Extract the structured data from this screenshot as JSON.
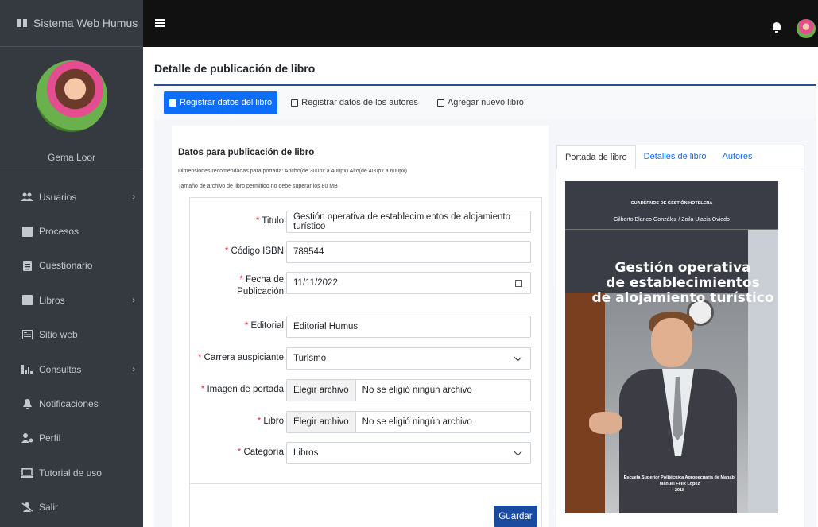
{
  "app": {
    "brand": "Sistema Web Humus",
    "user_name": "Gema Loor"
  },
  "sidebar": {
    "items": [
      {
        "label": "Usuarios",
        "icon": "users-icon",
        "has_submenu": true
      },
      {
        "label": "Procesos",
        "icon": "clipboard-icon",
        "has_submenu": false
      },
      {
        "label": "Cuestionario",
        "icon": "file-text-icon",
        "has_submenu": false
      },
      {
        "label": "Libros",
        "icon": "book-icon",
        "has_submenu": true
      },
      {
        "label": "Sitio web",
        "icon": "website-icon",
        "has_submenu": false
      },
      {
        "label": "Consultas",
        "icon": "bar-chart-icon",
        "has_submenu": true
      },
      {
        "label": "Notificaciones",
        "icon": "bell-icon",
        "has_submenu": false
      },
      {
        "label": "Perfil",
        "icon": "user-cog-icon",
        "has_submenu": false
      },
      {
        "label": "Tutorial de uso",
        "icon": "laptop-icon",
        "has_submenu": false
      },
      {
        "label": "Salir",
        "icon": "logout-icon",
        "has_submenu": false
      }
    ]
  },
  "page": {
    "title": "Detalle de publicación de libro"
  },
  "top_tabs": [
    {
      "label": "Registrar datos del libro",
      "active": true
    },
    {
      "label": "Registrar datos de los autores",
      "active": false
    },
    {
      "label": "Agregar nuevo libro",
      "active": false
    }
  ],
  "form": {
    "heading": "Datos para publicación de libro",
    "hint_dimensions": "Dimensiones recomendadas para portada: Ancho(de 300px a 400px) Alto(de 400px a 600px)",
    "hint_size": "Tamaño de archivo de libro permitido no debe superar los 80 MB",
    "required_mark": "*",
    "titulo": {
      "label": "Titulo",
      "value": "Gestión operativa de establecimientos de alojamiento turístico"
    },
    "isbn": {
      "label": "Código ISBN",
      "value": "789544"
    },
    "fecha": {
      "label_1": "Fecha de",
      "label_2": "Publicación",
      "value": "11/11/2022"
    },
    "editorial": {
      "label": "Editorial",
      "value": "Editorial Humus"
    },
    "carrera": {
      "label": "Carrera auspiciante",
      "value": "Turismo"
    },
    "portada": {
      "label": "Imagen de portada",
      "button": "Elegir archivo",
      "status": "No se eligió ningún archivo"
    },
    "libro": {
      "label": "Libro",
      "button": "Elegir archivo",
      "status": "No se eligió ningún archivo"
    },
    "categoria": {
      "label": "Categoría",
      "value": "Libros"
    },
    "save_label": "Guardar"
  },
  "preview": {
    "tabs": [
      {
        "label": "Portada de libro",
        "active": true
      },
      {
        "label": "Detalles de libro",
        "active": false
      },
      {
        "label": "Autores",
        "active": false
      }
    ],
    "cover": {
      "collection": "CUADERNOS DE GESTIÓN HOTELERA",
      "authors": "Gilberto Blanco González / Zoila Ulacia Oviedo",
      "title_lines": [
        "Gestión operativa",
        "de establecimientos",
        "de alojamiento turístico"
      ],
      "footer_1": "Escuela Superior Politécnica Agropecuaria de Manabí",
      "footer_2": "Manuel Félix López",
      "footer_3": "2018"
    }
  },
  "colors": {
    "primary": "#0d6efd",
    "save": "#1a4aa0",
    "sidebar": "#343a40",
    "topbar": "#111111",
    "required": "#dc3545"
  }
}
